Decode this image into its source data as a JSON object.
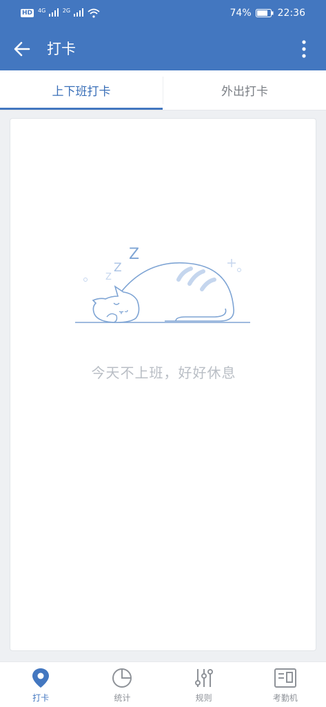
{
  "status_bar": {
    "hd_badge": "HD",
    "net_1": "4G",
    "net_2": "2G",
    "battery": "74%",
    "time": "22:36"
  },
  "app_bar": {
    "title": "打卡",
    "back_icon": "arrow-left-icon",
    "more_icon": "more-vertical-icon"
  },
  "tabs": [
    {
      "label": "上下班打卡",
      "active": true
    },
    {
      "label": "外出打卡",
      "active": false
    }
  ],
  "empty_state": {
    "message": "今天不上班，好好休息",
    "illustration": "sleeping-cat",
    "zzz": "Z"
  },
  "bottom_nav": [
    {
      "label": "打卡",
      "icon": "location-pin-icon",
      "active": true
    },
    {
      "label": "统计",
      "icon": "pie-chart-icon",
      "active": false
    },
    {
      "label": "规则",
      "icon": "sliders-icon",
      "active": false
    },
    {
      "label": "考勤机",
      "icon": "attendance-machine-icon",
      "active": false
    }
  ],
  "colors": {
    "primary": "#4377c0",
    "illustration": "#7ea4d4",
    "muted_text": "#b9bec5"
  }
}
